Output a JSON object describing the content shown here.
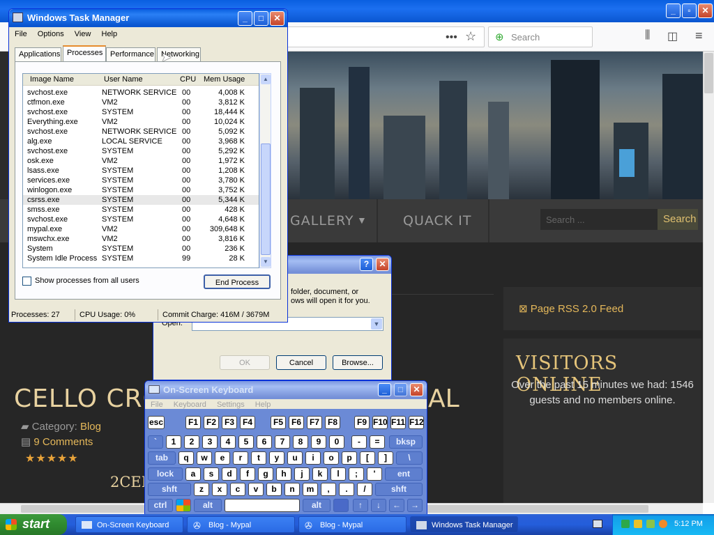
{
  "browser": {
    "search_placeholder": "Search",
    "site": {
      "nav": [
        "E GALLERY",
        "QUACK IT"
      ],
      "search_placeholder": "Search ...",
      "search_button": "Search",
      "rss_label": "Page RSS 2.0 Feed",
      "visitors_title": "VISITORS ONLINE",
      "visitors_text": "Over the past 15 minutes we had: 1546 guests and no members online.",
      "post_title": "CELLO CROSSO",
      "post_title_tail": "AL",
      "category_label": "Category:",
      "category_value": "Blog",
      "comments": "9 Comments",
      "rating_stars": 5,
      "post_sub": "2CELL"
    }
  },
  "taskmgr": {
    "title": "Windows Task Manager",
    "menu": [
      "File",
      "Options",
      "View",
      "Help"
    ],
    "tabs": [
      "Applications",
      "Processes",
      "Performance",
      "Networking"
    ],
    "active_tab": "Processes",
    "columns": [
      "Image Name",
      "User Name",
      "CPU",
      "Mem Usage"
    ],
    "processes": [
      [
        "svchost.exe",
        "NETWORK SERVICE",
        "00",
        "4,008 K"
      ],
      [
        "ctfmon.exe",
        "VM2",
        "00",
        "3,812 K"
      ],
      [
        "svchost.exe",
        "SYSTEM",
        "00",
        "18,444 K"
      ],
      [
        "Everything.exe",
        "VM2",
        "00",
        "10,024 K"
      ],
      [
        "svchost.exe",
        "NETWORK SERVICE",
        "00",
        "5,092 K"
      ],
      [
        "alg.exe",
        "LOCAL SERVICE",
        "00",
        "3,968 K"
      ],
      [
        "svchost.exe",
        "SYSTEM",
        "00",
        "5,292 K"
      ],
      [
        "osk.exe",
        "VM2",
        "00",
        "1,972 K"
      ],
      [
        "lsass.exe",
        "SYSTEM",
        "00",
        "1,208 K"
      ],
      [
        "services.exe",
        "SYSTEM",
        "00",
        "3,780 K"
      ],
      [
        "winlogon.exe",
        "SYSTEM",
        "00",
        "3,752 K"
      ],
      [
        "csrss.exe",
        "SYSTEM",
        "00",
        "5,344 K"
      ],
      [
        "smss.exe",
        "SYSTEM",
        "00",
        "428 K"
      ],
      [
        "svchost.exe",
        "SYSTEM",
        "00",
        "4,648 K"
      ],
      [
        "mypal.exe",
        "VM2",
        "00",
        "309,648 K"
      ],
      [
        "mswchx.exe",
        "VM2",
        "00",
        "3,816 K"
      ],
      [
        "System",
        "SYSTEM",
        "00",
        "236 K"
      ],
      [
        "System Idle Process",
        "SYSTEM",
        "99",
        "28 K"
      ]
    ],
    "selected_index": 11,
    "show_all_label": "Show processes from all users",
    "end_process": "End Process",
    "status": [
      "Processes: 27",
      "CPU Usage: 0%",
      "Commit Charge: 416M / 3679M"
    ]
  },
  "run": {
    "text_line1": "folder, document, or",
    "text_line2": "ows will open it for you.",
    "open_label": "Open:",
    "ok": "OK",
    "cancel": "Cancel",
    "browse": "Browse..."
  },
  "osk": {
    "title": "On-Screen Keyboard",
    "menu": [
      "File",
      "Keyboard",
      "Settings",
      "Help"
    ],
    "rows": [
      [
        "esc",
        "F1",
        "F2",
        "F3",
        "F4",
        "F5",
        "F6",
        "F7",
        "F8",
        "F9",
        "F10",
        "F11",
        "F12"
      ],
      [
        "`",
        "1",
        "2",
        "3",
        "4",
        "5",
        "6",
        "7",
        "8",
        "9",
        "0",
        "-",
        "=",
        "bksp"
      ],
      [
        "tab",
        "q",
        "w",
        "e",
        "r",
        "t",
        "y",
        "u",
        "i",
        "o",
        "p",
        "[",
        "]",
        "\\"
      ],
      [
        "lock",
        "a",
        "s",
        "d",
        "f",
        "g",
        "h",
        "j",
        "k",
        "l",
        ";",
        "'",
        "ent"
      ],
      [
        "shft",
        "z",
        "x",
        "c",
        "v",
        "b",
        "n",
        "m",
        ",",
        ".",
        "/",
        "shft"
      ],
      [
        "ctrl",
        "",
        "alt",
        "",
        "alt",
        "",
        "↑",
        "↓",
        "←",
        "→"
      ]
    ]
  },
  "taskbar": {
    "start": "start",
    "buttons": [
      "On-Screen Keyboard",
      "Blog - Mypal",
      "Blog - Mypal",
      "Windows Task Manager"
    ],
    "active": 3,
    "clock": "5:12 PM"
  },
  "colors": {
    "xp_blue": "#0a5fe0",
    "accent_gold": "#e5b85a",
    "start_green": "#3c9a3c"
  }
}
